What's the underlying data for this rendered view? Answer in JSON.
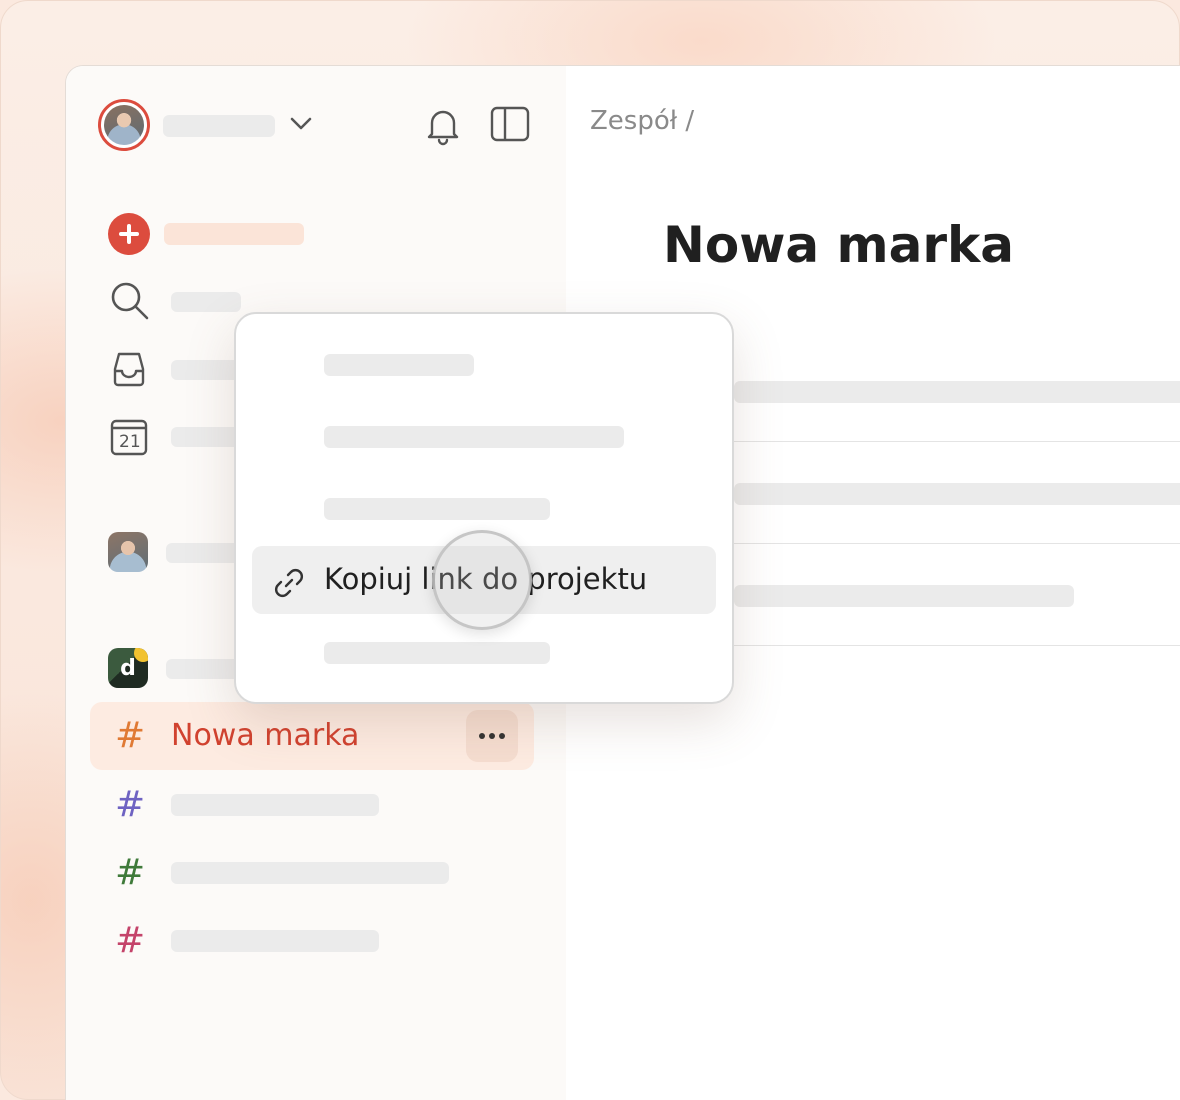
{
  "main": {
    "breadcrumb": "Zespół /",
    "title": "Nowa marka"
  },
  "sidebar": {
    "active_project": {
      "label": "Nowa marka",
      "color": "#e07a34"
    },
    "project_colors": [
      "#6e62c2",
      "#3f7a3a",
      "#c4436a"
    ],
    "team_logo_letter": "d",
    "icons": [
      "user-avatar",
      "chevron-down-icon",
      "bell-icon",
      "sidebar-toggle-icon",
      "plus-icon",
      "search-icon",
      "inbox-icon",
      "calendar-icon",
      "hash-icon",
      "more-icon"
    ],
    "calendar_day": "21"
  },
  "context_menu": {
    "highlighted_item": {
      "label": "Kopiuj link do projektu",
      "icon": "link-icon"
    }
  },
  "colors": {
    "accent": "#dc4c3e",
    "active_text": "#d1422f"
  }
}
